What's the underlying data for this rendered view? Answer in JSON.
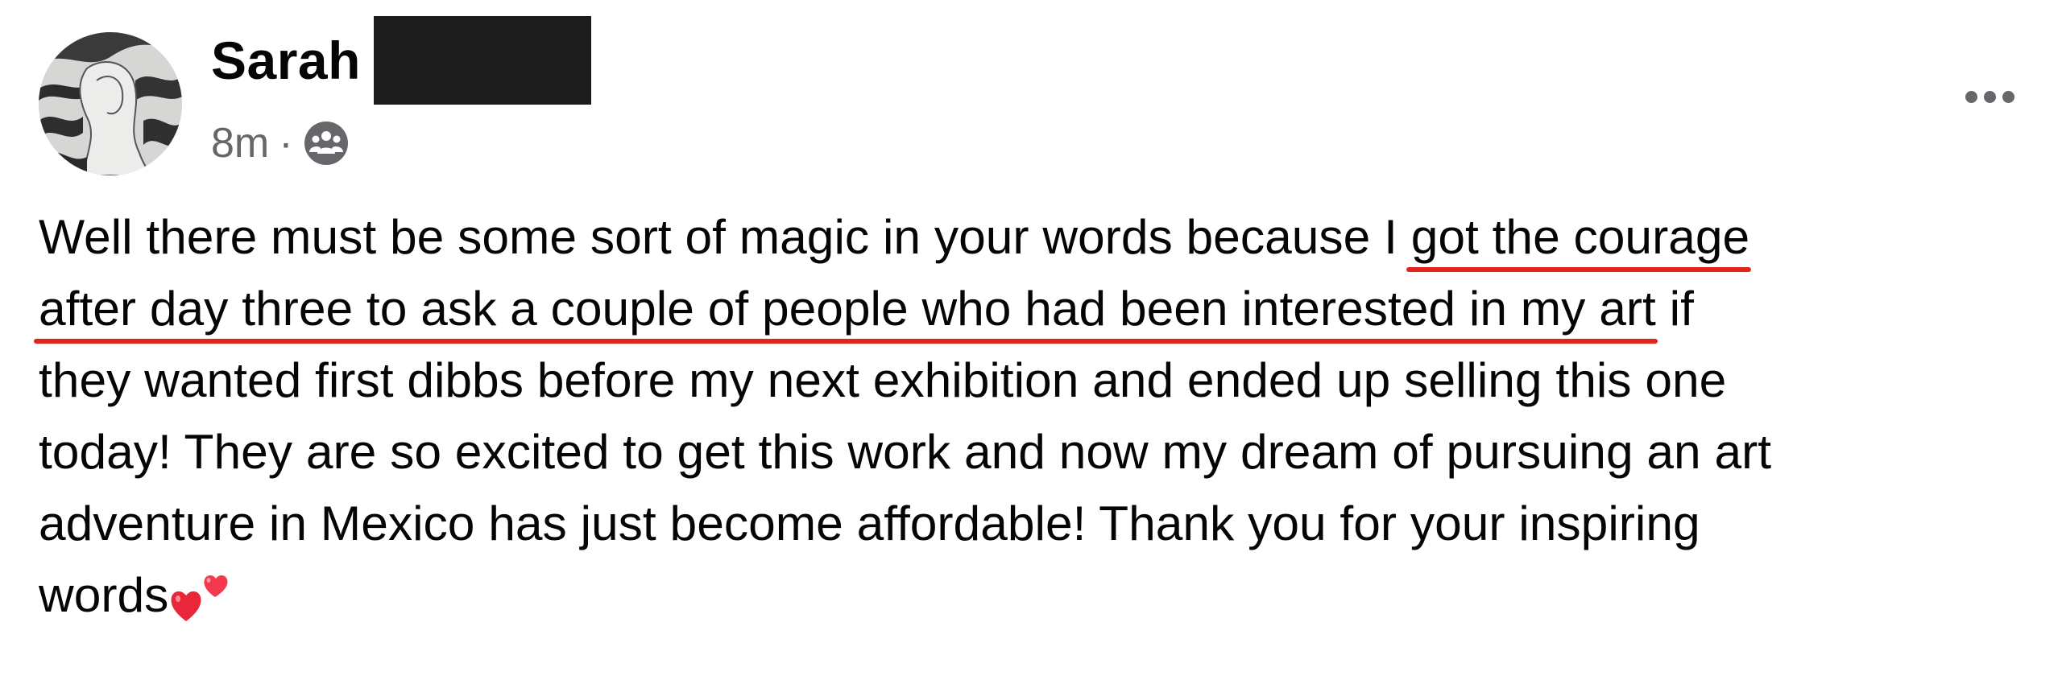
{
  "author": {
    "name": "Sarah",
    "avatar_icon": "sketch-portrait-avatar"
  },
  "meta": {
    "time": "8m",
    "separator": "·",
    "audience_icon": "friends-audience-icon"
  },
  "more_icon": "more-options-icon",
  "post": {
    "line1_a": "Well there must be some sort of magic in your words because I ",
    "line1_b": "got the courage",
    "line2_a": "after day three to ask a couple of people who had been interested in my art",
    "line2_b": " if",
    "line3": "they wanted first dibbs before my next exhibition and ended up selling this one",
    "line4": "today! They are so excited to get this work and now my dream of pursuing an art",
    "line5": "adventure in Mexico has just become affordable! Thank you for your inspiring",
    "line6": "words",
    "emoji": "two-hearts-emoji"
  },
  "colors": {
    "underline": "#e1251b",
    "secondary_text": "#65676b",
    "redaction": "#1c1c1c"
  }
}
